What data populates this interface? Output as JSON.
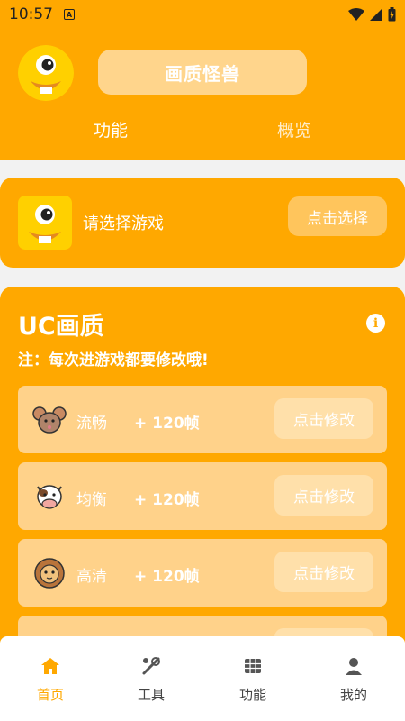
{
  "status": {
    "time": "10:57",
    "indicator": "A"
  },
  "header": {
    "title": "画质怪兽",
    "tabs": [
      {
        "label": "功能"
      },
      {
        "label": "概览"
      }
    ]
  },
  "select_card": {
    "prompt": "请选择游戏",
    "button": "点击选择"
  },
  "uc_card": {
    "title": "UC画质",
    "note": "注：每次进游戏都要修改哦!",
    "rows": [
      {
        "name": "流畅",
        "fps": "+ 120帧",
        "button": "点击修改",
        "icon": "mouse-icon"
      },
      {
        "name": "均衡",
        "fps": "+ 120帧",
        "button": "点击修改",
        "icon": "cow-icon"
      },
      {
        "name": "高清",
        "fps": "+ 120帧",
        "button": "点击修改",
        "icon": "lion-icon"
      }
    ]
  },
  "bottom_nav": {
    "items": [
      {
        "label": "首页",
        "icon": "home-icon"
      },
      {
        "label": "工具",
        "icon": "tools-icon"
      },
      {
        "label": "功能",
        "icon": "grid-icon"
      },
      {
        "label": "我的",
        "icon": "person-icon"
      }
    ]
  },
  "colors": {
    "accent": "#FFA800",
    "light_accent": "#FFD28A"
  }
}
